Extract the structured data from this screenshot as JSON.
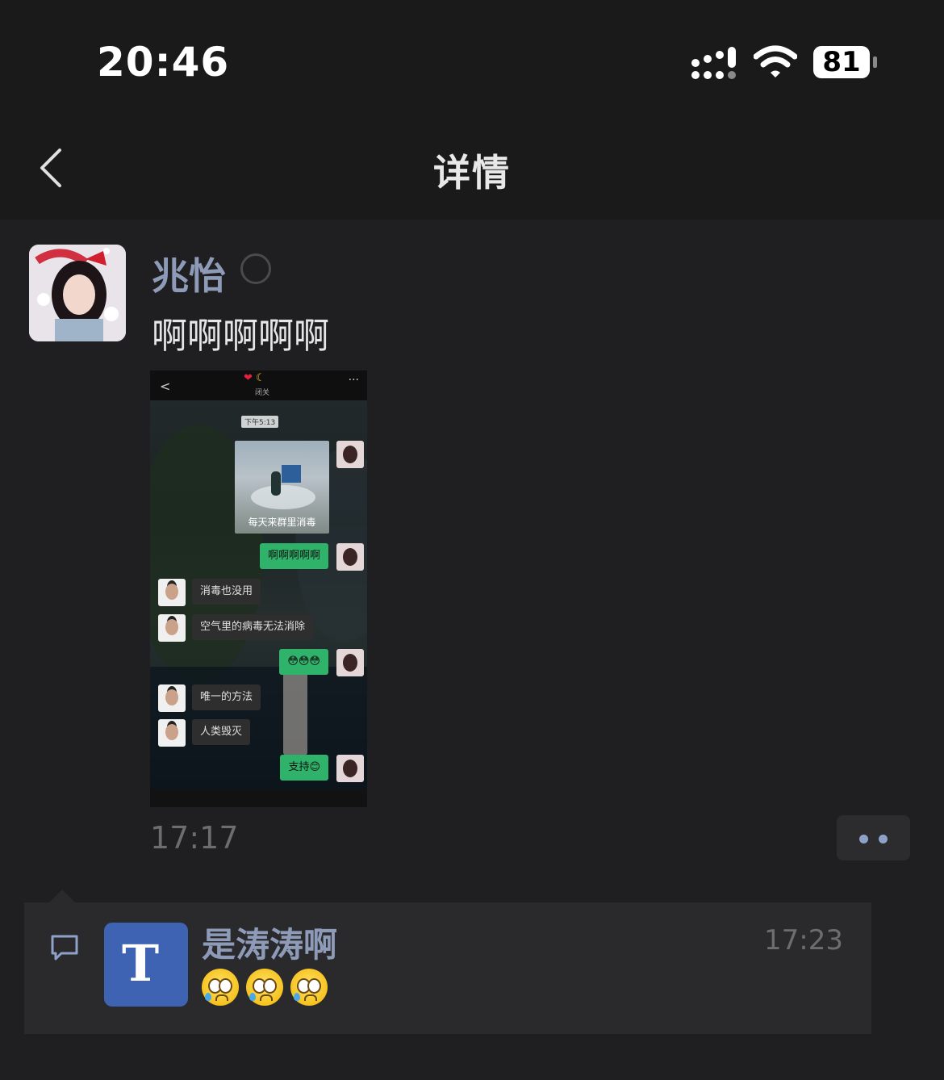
{
  "status_bar": {
    "time": "20:46",
    "battery": "81"
  },
  "nav": {
    "title": "详情"
  },
  "post": {
    "author": "兆怡",
    "text": "啊啊啊啊啊",
    "time": "17:17",
    "screenshot": {
      "header_status": "闭关",
      "timestamp": "下午5:13",
      "image_caption": "每天来群里消毒",
      "messages": [
        {
          "side": "right",
          "text": "啊啊啊啊啊"
        },
        {
          "side": "left",
          "text": "消毒也没用"
        },
        {
          "side": "left",
          "text": "空气里的病毒无法消除"
        },
        {
          "side": "right",
          "text": "😳😳😳"
        },
        {
          "side": "left",
          "text": "唯一的方法"
        },
        {
          "side": "left",
          "text": "人类毁灭"
        },
        {
          "side": "right",
          "text": "支持😊"
        }
      ]
    }
  },
  "comment": {
    "author": "是涛涛啊",
    "time": "17:23",
    "avatar_text": "T",
    "emoji_icons": [
      "pleading-sweat-face",
      "pleading-sweat-face",
      "pleading-sweat-face"
    ]
  },
  "colors": {
    "name": "#8e9bb8",
    "background": "#1f1f21",
    "bubble_green": "#2fb36a"
  }
}
